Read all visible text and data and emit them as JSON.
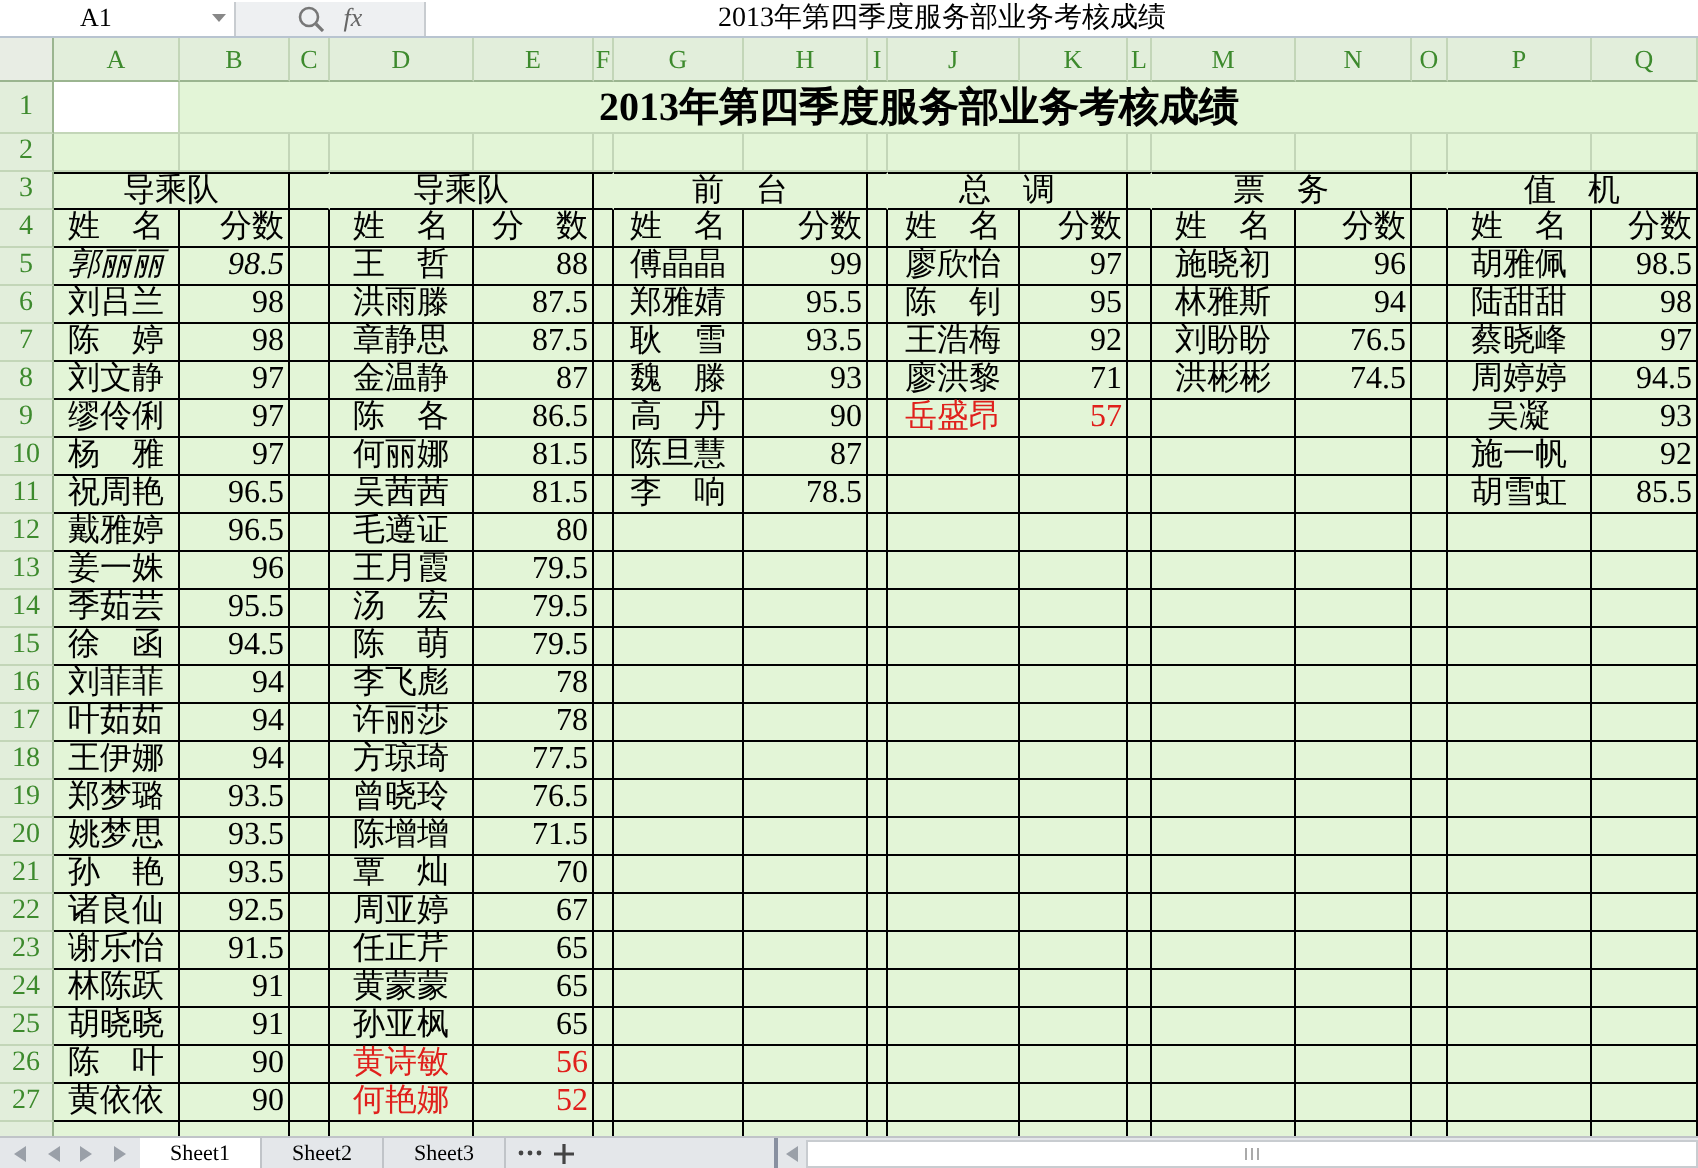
{
  "formula_bar": {
    "cell_ref": "A1",
    "fx": "fx",
    "content": "2013年第四季度服务部业务考核成绩"
  },
  "columns": [
    "A",
    "B",
    "C",
    "D",
    "E",
    "F",
    "G",
    "H",
    "I",
    "J",
    "K",
    "L",
    "M",
    "N",
    "O",
    "P",
    "Q"
  ],
  "row_numbers": [
    "1",
    "2",
    "3",
    "4",
    "5",
    "6",
    "7",
    "8",
    "9",
    "10",
    "11",
    "12",
    "13",
    "14",
    "15",
    "16",
    "17",
    "18",
    "19",
    "20",
    "21",
    "22",
    "23",
    "24",
    "25",
    "26",
    "27"
  ],
  "title": "2013年第四季度服务部业务考核成绩",
  "groups": [
    {
      "header": "导乘队",
      "name_label": "姓　名",
      "score_label": "分数",
      "entries": [
        {
          "name": "郭丽丽",
          "score": "98.5",
          "kind": "italic"
        },
        {
          "name": "刘吕兰",
          "score": "98",
          "kind": "normal"
        },
        {
          "name": "陈　婷",
          "score": "98",
          "kind": "normal"
        },
        {
          "name": "刘文静",
          "score": "97",
          "kind": "normal"
        },
        {
          "name": "缪伶俐",
          "score": "97",
          "kind": "normal"
        },
        {
          "name": "杨　雅",
          "score": "97",
          "kind": "normal"
        },
        {
          "name": "祝周艳",
          "score": "96.5",
          "kind": "normal"
        },
        {
          "name": "戴雅婷",
          "score": "96.5",
          "kind": "normal"
        },
        {
          "name": "姜一姝",
          "score": "96",
          "kind": "normal"
        },
        {
          "name": "季茹芸",
          "score": "95.5",
          "kind": "normal"
        },
        {
          "name": "徐　函",
          "score": "94.5",
          "kind": "normal"
        },
        {
          "name": "刘菲菲",
          "score": "94",
          "kind": "normal"
        },
        {
          "name": "叶茹茹",
          "score": "94",
          "kind": "normal"
        },
        {
          "name": "王伊娜",
          "score": "94",
          "kind": "normal"
        },
        {
          "name": "郑梦璐",
          "score": "93.5",
          "kind": "normal"
        },
        {
          "name": "姚梦思",
          "score": "93.5",
          "kind": "normal"
        },
        {
          "name": "孙　艳",
          "score": "93.5",
          "kind": "normal"
        },
        {
          "name": "诸良仙",
          "score": "92.5",
          "kind": "normal"
        },
        {
          "name": "谢乐怡",
          "score": "91.5",
          "kind": "normal"
        },
        {
          "name": "林陈跃",
          "score": "91",
          "kind": "normal"
        },
        {
          "name": "胡晓晓",
          "score": "91",
          "kind": "normal"
        },
        {
          "name": "陈　叶",
          "score": "90",
          "kind": "normal"
        },
        {
          "name": "黄依依",
          "score": "90",
          "kind": "normal"
        }
      ]
    },
    {
      "header": "导乘队",
      "name_label": "姓　名",
      "score_label": "分　数",
      "entries": [
        {
          "name": "王　哲",
          "score": "88",
          "kind": "normal"
        },
        {
          "name": "洪雨滕",
          "score": "87.5",
          "kind": "normal"
        },
        {
          "name": "章静思",
          "score": "87.5",
          "kind": "normal"
        },
        {
          "name": "金温静",
          "score": "87",
          "kind": "normal"
        },
        {
          "name": "陈　各",
          "score": "86.5",
          "kind": "normal"
        },
        {
          "name": "何丽娜",
          "score": "81.5",
          "kind": "normal"
        },
        {
          "name": "吴茜茜",
          "score": "81.5",
          "kind": "normal"
        },
        {
          "name": "毛遵证",
          "score": "80",
          "kind": "normal"
        },
        {
          "name": "王月霞",
          "score": "79.5",
          "kind": "normal"
        },
        {
          "name": "汤　宏",
          "score": "79.5",
          "kind": "normal"
        },
        {
          "name": "陈　萌",
          "score": "79.5",
          "kind": "normal"
        },
        {
          "name": "李飞彪",
          "score": "78",
          "kind": "normal"
        },
        {
          "name": "许丽莎",
          "score": "78",
          "kind": "normal"
        },
        {
          "name": "方琼琦",
          "score": "77.5",
          "kind": "normal"
        },
        {
          "name": "曾晓玲",
          "score": "76.5",
          "kind": "normal"
        },
        {
          "name": "陈增增",
          "score": "71.5",
          "kind": "normal"
        },
        {
          "name": "覃　灿",
          "score": "70",
          "kind": "normal"
        },
        {
          "name": "周亚婷",
          "score": "67",
          "kind": "normal"
        },
        {
          "name": "任正芹",
          "score": "65",
          "kind": "normal"
        },
        {
          "name": "黄蒙蒙",
          "score": "65",
          "kind": "normal"
        },
        {
          "name": "孙亚枫",
          "score": "65",
          "kind": "normal"
        },
        {
          "name": "黄诗敏",
          "score": "56",
          "kind": "low"
        },
        {
          "name": "何艳娜",
          "score": "52",
          "kind": "low"
        }
      ]
    },
    {
      "header": "前　台",
      "name_label": "姓　名",
      "score_label": "分数",
      "entries": [
        {
          "name": "傅晶晶",
          "score": "99",
          "kind": "normal"
        },
        {
          "name": "郑雅婧",
          "score": "95.5",
          "kind": "normal"
        },
        {
          "name": "耿　雪",
          "score": "93.5",
          "kind": "normal"
        },
        {
          "name": "魏　滕",
          "score": "93",
          "kind": "normal"
        },
        {
          "name": "高　丹",
          "score": "90",
          "kind": "normal"
        },
        {
          "name": "陈旦慧",
          "score": "87",
          "kind": "normal"
        },
        {
          "name": "李　响",
          "score": "78.5",
          "kind": "normal"
        }
      ]
    },
    {
      "header": "总　调",
      "name_label": "姓　名",
      "score_label": "分数",
      "entries": [
        {
          "name": "廖欣怡",
          "score": "97",
          "kind": "normal"
        },
        {
          "name": "陈　钊",
          "score": "95",
          "kind": "normal"
        },
        {
          "name": "王浩梅",
          "score": "92",
          "kind": "normal"
        },
        {
          "name": "廖洪黎",
          "score": "71",
          "kind": "normal"
        },
        {
          "name": "岳盛昂",
          "score": "57",
          "kind": "low"
        }
      ]
    },
    {
      "header": "票　务",
      "name_label": "姓　名",
      "score_label": "分数",
      "entries": [
        {
          "name": "施晓初",
          "score": "96",
          "kind": "normal"
        },
        {
          "name": "林雅斯",
          "score": "94",
          "kind": "normal"
        },
        {
          "name": "刘盼盼",
          "score": "76.5",
          "kind": "normal"
        },
        {
          "name": "洪彬彬",
          "score": "74.5",
          "kind": "normal"
        }
      ]
    },
    {
      "header": "值　机",
      "name_label": "姓　名",
      "score_label": "分数",
      "entries": [
        {
          "name": "胡雅佩",
          "score": "98.5",
          "kind": "normal"
        },
        {
          "name": "陆甜甜",
          "score": "98",
          "kind": "normal"
        },
        {
          "name": "蔡晓峰",
          "score": "97",
          "kind": "normal"
        },
        {
          "name": "周婷婷",
          "score": "94.5",
          "kind": "normal"
        },
        {
          "name": "吴凝",
          "score": "93",
          "kind": "normal"
        },
        {
          "name": "施一帆",
          "score": "92",
          "kind": "normal"
        },
        {
          "name": "胡雪虹",
          "score": "85.5",
          "kind": "normal"
        }
      ]
    }
  ],
  "sheet_tabs": [
    {
      "label": "Sheet1",
      "selected": true
    },
    {
      "label": "Sheet2",
      "selected": false
    },
    {
      "label": "Sheet3",
      "selected": false
    }
  ]
}
